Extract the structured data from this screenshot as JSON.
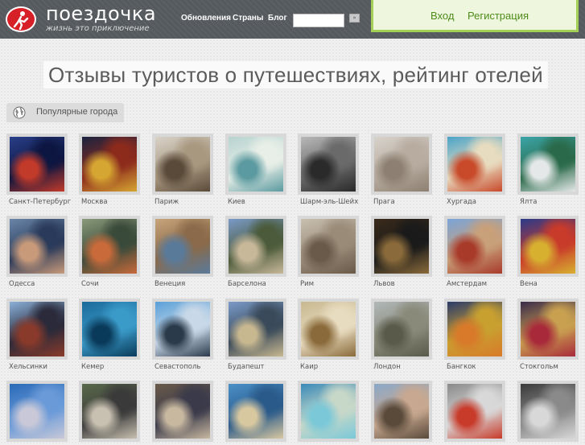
{
  "header": {
    "logo_name": "поездочка",
    "logo_tagline": "жизнь это приключение",
    "nav": [
      "Обновления",
      "Страны",
      "Блог"
    ],
    "search_value": "",
    "search_button": "»",
    "auth": {
      "login": "Вход",
      "register": "Регистрация"
    }
  },
  "main": {
    "title": "Отзывы туристов о путешествиях, рейтинг отелей",
    "section_label": "Популярные города"
  },
  "cities": [
    {
      "name": "Санкт-Петербург",
      "colors": [
        "#2a3f8a",
        "#c23a2a",
        "#0d1640"
      ]
    },
    {
      "name": "Москва",
      "colors": [
        "#1b2340",
        "#d6a632",
        "#8c2a1c"
      ]
    },
    {
      "name": "Париж",
      "colors": [
        "#d8d2c8",
        "#5a4a3a",
        "#a89880"
      ]
    },
    {
      "name": "Киев",
      "colors": [
        "#b7d3d0",
        "#5b9aa0",
        "#e8efe8"
      ]
    },
    {
      "name": "Шарм-эль-Шейх",
      "colors": [
        "#b8b8b8",
        "#2a2a2a",
        "#6a6a6a"
      ]
    },
    {
      "name": "Прага",
      "colors": [
        "#d7d2cb",
        "#8d8072",
        "#b8aca0"
      ]
    },
    {
      "name": "Хургада",
      "colors": [
        "#4aa3c8",
        "#c84a2a",
        "#e8dcc0"
      ]
    },
    {
      "name": "Ялта",
      "colors": [
        "#3ba5a8",
        "#e4e8e8",
        "#2a6a4a"
      ]
    },
    {
      "name": "Одесса",
      "colors": [
        "#6a86a8",
        "#c89a7a",
        "#2a3a5a"
      ]
    },
    {
      "name": "Сочи",
      "colors": [
        "#8a9a7a",
        "#c86a3a",
        "#3a4a3a"
      ]
    },
    {
      "name": "Венеция",
      "colors": [
        "#c8a47a",
        "#5a7a9a",
        "#8a6a4a"
      ]
    },
    {
      "name": "Барселона",
      "colors": [
        "#7a9ac8",
        "#c8b89a",
        "#4a5a3a"
      ]
    },
    {
      "name": "Рим",
      "colors": [
        "#c8c0b0",
        "#6a5a4a",
        "#9a8a78"
      ]
    },
    {
      "name": "Львов",
      "colors": [
        "#3a2a1a",
        "#8a6a3a",
        "#1a1a1a"
      ]
    },
    {
      "name": "Амстердам",
      "colors": [
        "#7aa4d8",
        "#a83a2a",
        "#c8a07a"
      ]
    },
    {
      "name": "Вена",
      "colors": [
        "#2a3a8a",
        "#d8b030",
        "#c83a2a"
      ]
    },
    {
      "name": "Хельсинки",
      "colors": [
        "#8ab0d8",
        "#8a3a2a",
        "#2a2a3a"
      ]
    },
    {
      "name": "Кемер",
      "colors": [
        "#1a6a9a",
        "#0a3a5a",
        "#3a9ac8"
      ]
    },
    {
      "name": "Севастополь",
      "colors": [
        "#5aa0d8",
        "#2a3a4a",
        "#c8d8e8"
      ]
    },
    {
      "name": "Будапешт",
      "colors": [
        "#7a9ac8",
        "#c8b890",
        "#3a4a5a"
      ]
    },
    {
      "name": "Каир",
      "colors": [
        "#c8b890",
        "#8a6a3a",
        "#e8dcc0"
      ]
    },
    {
      "name": "Лондон",
      "colors": [
        "#b0b8b8",
        "#5a5a4a",
        "#8a8a7a"
      ]
    },
    {
      "name": "Бангкок",
      "colors": [
        "#2a3a6a",
        "#d87a2a",
        "#c8a030"
      ]
    },
    {
      "name": "Стокгольм",
      "colors": [
        "#3a2a4a",
        "#a82a3a",
        "#c8a050"
      ]
    },
    {
      "name": "",
      "colors": [
        "#2a6ab8",
        "#c8c8d8",
        "#6a9ad8"
      ]
    },
    {
      "name": "",
      "colors": [
        "#5a6a4a",
        "#c8c0b0",
        "#3a3a3a"
      ]
    },
    {
      "name": "",
      "colors": [
        "#6a5a4a",
        "#c8b8a0",
        "#3a3a4a"
      ]
    },
    {
      "name": "",
      "colors": [
        "#4a90c8",
        "#d8c8a0",
        "#2a5a8a"
      ]
    },
    {
      "name": "",
      "colors": [
        "#3a8ab8",
        "#7ac8d8",
        "#c8d8c8"
      ]
    },
    {
      "name": "",
      "colors": [
        "#8aa8c8",
        "#5a4a3a",
        "#c8a890"
      ]
    },
    {
      "name": "",
      "colors": [
        "#8a8a8a",
        "#c83a2a",
        "#d8d8d8"
      ]
    },
    {
      "name": "",
      "colors": [
        "#3a3a3a",
        "#d8d8d8",
        "#8a8a8a"
      ]
    }
  ]
}
